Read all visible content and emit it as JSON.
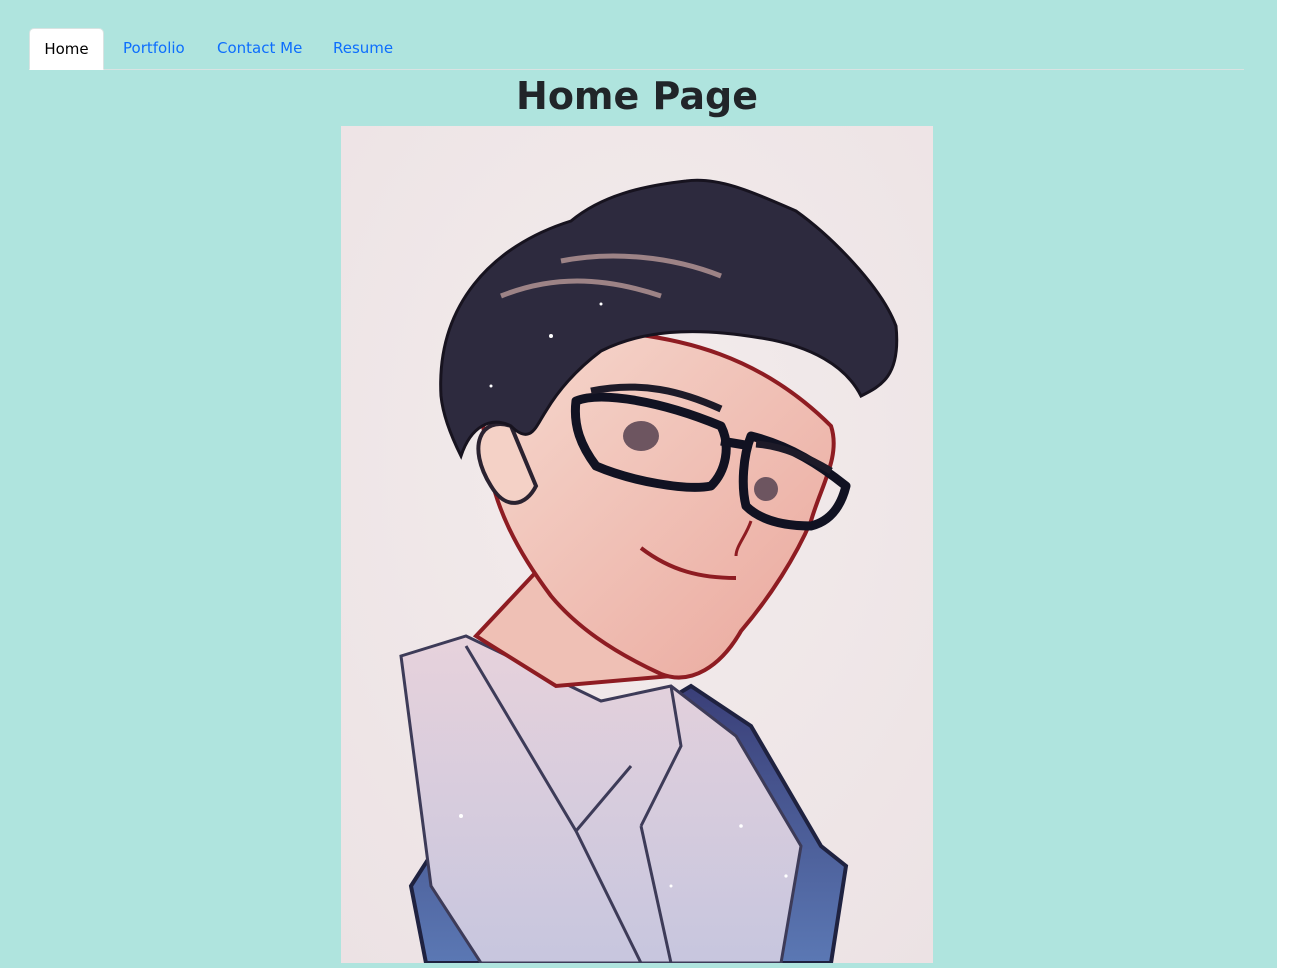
{
  "nav": {
    "tabs": [
      {
        "label": "Home",
        "active": true
      },
      {
        "label": "Portfolio",
        "active": false
      },
      {
        "label": "Contact Me",
        "active": false
      },
      {
        "label": "Resume",
        "active": false
      }
    ]
  },
  "main": {
    "title": "Home Page",
    "image": {
      "description": "illustrated-portrait"
    }
  },
  "colors": {
    "page_background": "#afe4de",
    "link": "#0d6efd",
    "title": "#212529"
  }
}
